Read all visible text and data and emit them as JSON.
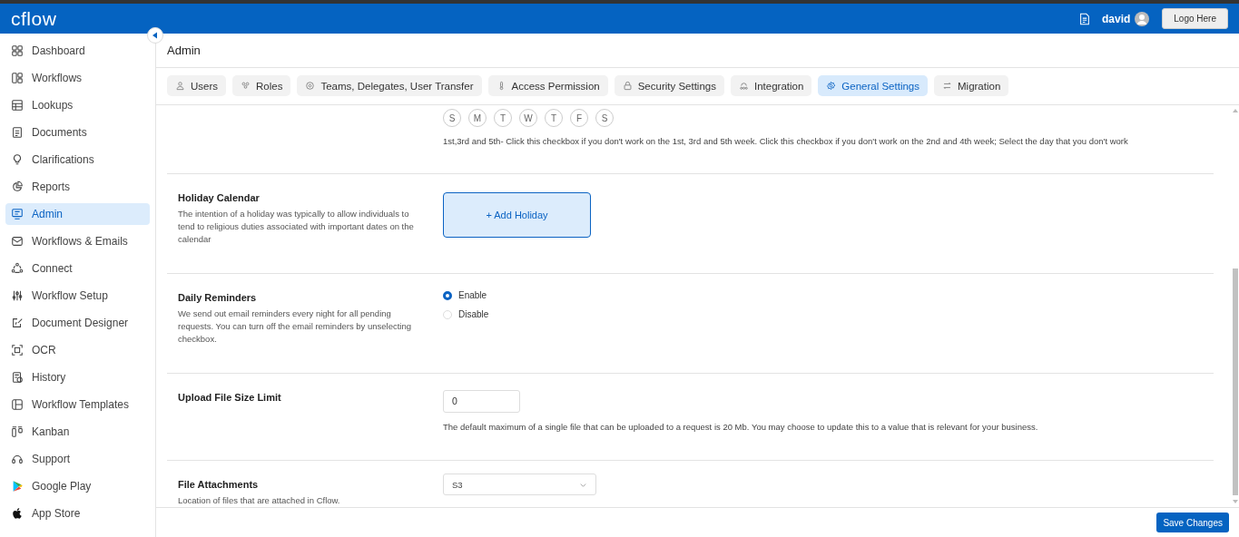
{
  "header": {
    "logo": "cflow",
    "user": "david",
    "logo_button": "Logo Here"
  },
  "sidebar": {
    "items": [
      {
        "label": "Dashboard",
        "selected": false
      },
      {
        "label": "Workflows",
        "selected": false
      },
      {
        "label": "Lookups",
        "selected": false
      },
      {
        "label": "Documents",
        "selected": false
      },
      {
        "label": "Clarifications",
        "selected": false
      },
      {
        "label": "Reports",
        "selected": false
      },
      {
        "label": "Admin",
        "selected": true
      },
      {
        "label": "Workflows & Emails",
        "selected": false
      },
      {
        "label": "Connect",
        "selected": false
      },
      {
        "label": "Workflow Setup",
        "selected": false
      },
      {
        "label": "Document Designer",
        "selected": false
      },
      {
        "label": "OCR",
        "selected": false
      },
      {
        "label": "History",
        "selected": false
      },
      {
        "label": "Workflow Templates",
        "selected": false
      },
      {
        "label": "Kanban",
        "selected": false
      },
      {
        "label": "Support",
        "selected": false
      },
      {
        "label": "Google Play",
        "selected": false
      },
      {
        "label": "App Store",
        "selected": false
      }
    ]
  },
  "page_title": "Admin",
  "tabs": [
    {
      "label": "Users",
      "selected": false
    },
    {
      "label": "Roles",
      "selected": false
    },
    {
      "label": "Teams, Delegates, User Transfer",
      "selected": false
    },
    {
      "label": "Access Permission",
      "selected": false
    },
    {
      "label": "Security Settings",
      "selected": false
    },
    {
      "label": "Integration",
      "selected": false
    },
    {
      "label": "General Settings",
      "selected": true
    },
    {
      "label": "Migration",
      "selected": false
    }
  ],
  "sections": [
    {
      "kind": "days",
      "days": [
        "S",
        "M",
        "T",
        "W",
        "T",
        "F",
        "S"
      ],
      "note": "1st,3rd and 5th- Click this checkbox if you don't work on the 1st, 3rd and 5th week. Click this checkbox if you don't work on the 2nd and 4th week; Select the day that you don't work"
    },
    {
      "kind": "button",
      "title": "Holiday Calendar",
      "description": "The intention of a holiday was typically to allow individuals to tend to religious duties associated with important dates on the calendar",
      "button": "+ Add Holiday"
    },
    {
      "kind": "radio",
      "title": "Daily Reminders",
      "description": "We send out email reminders every night for all pending requests. You can turn off the email reminders by unselecting checkbox.",
      "options": [
        {
          "label": "Enable",
          "selected": true
        },
        {
          "label": "Disable",
          "selected": false
        }
      ]
    },
    {
      "kind": "input",
      "title": "Upload File Size Limit",
      "value": "0",
      "note": "The default maximum of a single file that can be uploaded to a request is 20 Mb. You may choose to update this to a value that is relevant for your business."
    },
    {
      "kind": "select",
      "title": "File Attachments",
      "description": "Location of files that are attached in Cflow.",
      "value": "S3"
    }
  ],
  "footer": {
    "save_button": "Save Changes"
  }
}
